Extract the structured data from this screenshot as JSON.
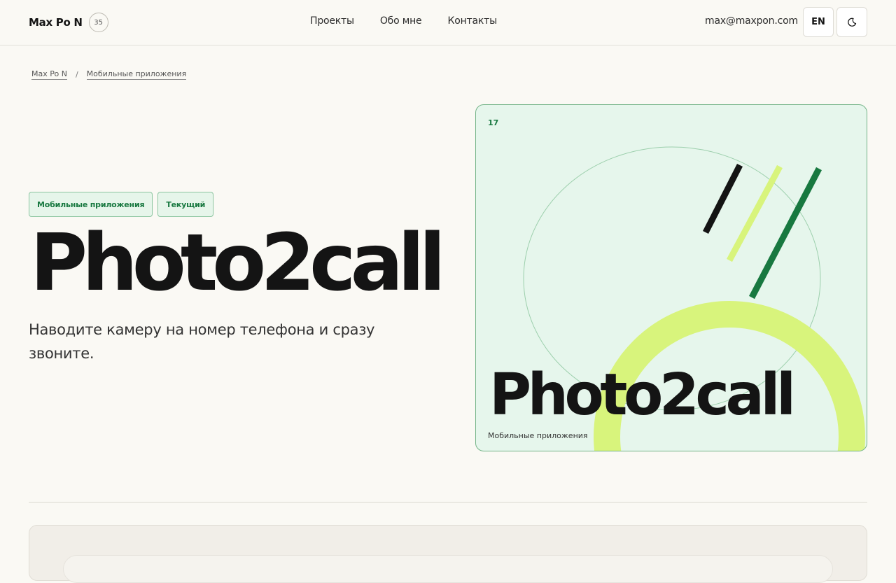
{
  "header": {
    "brand": "Max Po N",
    "brand_badge": "35",
    "nav": [
      "Проекты",
      "Обо мне",
      "Контакты"
    ],
    "email": "max@maxpon.com",
    "lang_button": "EN",
    "theme_icon": "moon-icon"
  },
  "breadcrumb": {
    "home": "Max Po N",
    "separator": "/",
    "current": "Мобильные приложения"
  },
  "hero": {
    "tags": [
      "Мобильные приложения",
      "Текущий"
    ],
    "title": "Photo2call",
    "subtitle": "Наводите камеру на номер телефона и сразу звоните."
  },
  "card": {
    "number": "17",
    "title": "Photo2call",
    "category": "Мобильные приложения"
  },
  "colors": {
    "accent_green": "#187840",
    "lime": "#d8f47c",
    "card_bg": "#e6f6ec",
    "page_bg": "#faf9f4"
  }
}
